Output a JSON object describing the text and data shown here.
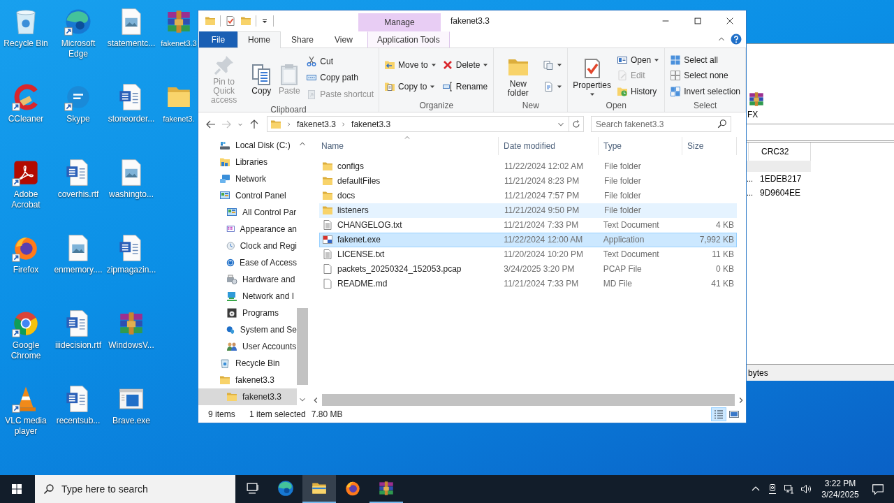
{
  "desktop_icons": [
    {
      "label": "Recycle Bin",
      "kind": "recycle-bin",
      "shortcut": false
    },
    {
      "label": "CCleaner",
      "kind": "ccleaner",
      "shortcut": true
    },
    {
      "label": "Adobe Acrobat",
      "kind": "pdf",
      "shortcut": true
    },
    {
      "label": "Firefox",
      "kind": "firefox",
      "shortcut": true
    },
    {
      "label": "Google Chrome",
      "kind": "chrome",
      "shortcut": true
    },
    {
      "label": "VLC media player",
      "kind": "vlc",
      "shortcut": true
    },
    {
      "label": "Microsoft Edge",
      "kind": "edge",
      "shortcut": true
    },
    {
      "label": "Skype",
      "kind": "skype",
      "shortcut": true
    },
    {
      "label": "coverhis.rtf",
      "kind": "word",
      "shortcut": false
    },
    {
      "label": "enmemory....",
      "kind": "image",
      "shortcut": false
    },
    {
      "label": "iiidecision.rtf",
      "kind": "word",
      "shortcut": false
    },
    {
      "label": "recentsub...",
      "kind": "word",
      "shortcut": false
    },
    {
      "label": "statementc...",
      "kind": "image",
      "shortcut": false
    },
    {
      "label": "stoneorder...",
      "kind": "word",
      "shortcut": false
    },
    {
      "label": "washingto...",
      "kind": "image",
      "shortcut": false
    },
    {
      "label": "zipmagazin...",
      "kind": "word",
      "shortcut": false
    },
    {
      "label": "WindowsV...",
      "kind": "archive",
      "shortcut": false
    },
    {
      "label": "Brave.exe",
      "kind": "app",
      "shortcut": false
    },
    {
      "label": "fakenet3.3",
      "kind": "archive",
      "shortcut": false
    },
    {
      "label": "fakenet3.",
      "kind": "folder",
      "shortcut": false
    }
  ],
  "background_window": {
    "toolbar_label": "FX",
    "crc_header": "CRC32",
    "rows": [
      {
        "column_1": "...",
        "crc32": "1EDEB217"
      },
      {
        "column_1": "...",
        "crc32": "9D9604EE"
      }
    ],
    "status": "bytes"
  },
  "explorer": {
    "quick_access": [
      {
        "kind": "folder"
      },
      {
        "kind": "properties"
      },
      {
        "kind": "folder"
      },
      {
        "kind": "customize"
      }
    ],
    "context_group": "Manage",
    "title": "fakenet3.3",
    "tabs": [
      {
        "label": "File",
        "kind": "file",
        "selected": false
      },
      {
        "label": "Home",
        "kind": "tab",
        "selected": true
      },
      {
        "label": "Share",
        "kind": "tab",
        "selected": false
      },
      {
        "label": "View",
        "kind": "tab",
        "selected": false
      },
      {
        "label": "Application Tools",
        "kind": "context",
        "selected": false
      }
    ],
    "ribbon": [
      {
        "label": "Clipboard",
        "columns": [
          [
            {
              "label": "Pin to Quick access",
              "kind": "pin",
              "disabled": true,
              "dropdown": false
            }
          ],
          [
            {
              "label": "Copy",
              "kind": "copy",
              "disabled": false,
              "dropdown": false
            }
          ],
          [
            {
              "label": "Paste",
              "kind": "paste",
              "disabled": true,
              "dropdown": false
            }
          ],
          [
            {
              "label": "Cut",
              "kind": "cut",
              "disabled": false,
              "dropdown": false
            },
            {
              "label": "Copy path",
              "kind": "copy-path",
              "disabled": false,
              "dropdown": false
            },
            {
              "label": "Paste shortcut",
              "kind": "paste-shortcut",
              "disabled": true,
              "dropdown": false
            }
          ]
        ]
      },
      {
        "label": "Organize",
        "columns": [
          [
            {
              "label": "Move to",
              "kind": "move-to",
              "disabled": false,
              "dropdown": true
            },
            {
              "label": "Copy to",
              "kind": "copy-to",
              "disabled": false,
              "dropdown": true
            }
          ],
          [
            {
              "label": "Delete",
              "kind": "delete",
              "disabled": false,
              "dropdown": true
            },
            {
              "label": "Rename",
              "kind": "rename",
              "disabled": false,
              "dropdown": false
            }
          ]
        ]
      },
      {
        "label": "New",
        "columns": [
          [
            {
              "label": "New folder",
              "kind": "folder",
              "disabled": false,
              "dropdown": false
            }
          ],
          [
            {
              "kind": "new-item",
              "disabled": false,
              "dropdown": true
            },
            {
              "kind": "easy-access",
              "disabled": false,
              "dropdown": true
            }
          ]
        ]
      },
      {
        "label": "Open",
        "columns": [
          [
            {
              "label": "Properties",
              "kind": "properties",
              "disabled": false,
              "dropdown": true
            }
          ],
          [
            {
              "label": "Open",
              "kind": "open",
              "disabled": false,
              "dropdown": true
            },
            {
              "label": "Edit",
              "kind": "edit",
              "disabled": true,
              "dropdown": false
            },
            {
              "label": "History",
              "kind": "history",
              "disabled": false,
              "dropdown": false
            }
          ]
        ]
      },
      {
        "label": "Select",
        "columns": [
          [
            {
              "label": "Select all",
              "kind": "select-all",
              "disabled": false,
              "dropdown": false
            },
            {
              "label": "Select none",
              "kind": "select-none",
              "disabled": false,
              "dropdown": false
            },
            {
              "label": "Invert selection",
              "kind": "invert",
              "disabled": false,
              "dropdown": false
            }
          ]
        ]
      }
    ],
    "nav_buttons": [
      {
        "kind": "back",
        "disabled": false
      },
      {
        "kind": "forward",
        "disabled": true
      },
      {
        "kind": "recent",
        "disabled": false
      },
      {
        "kind": "up",
        "disabled": false
      }
    ],
    "address": {
      "crumbs": [
        "fakenet3.3",
        "fakenet3.3"
      ]
    },
    "search": {
      "placeholder": "Search fakenet3.3"
    },
    "tree": [
      {
        "label": "Local Disk (C:)",
        "kind": "drive",
        "selected": false
      },
      {
        "label": "Libraries",
        "kind": "libraries",
        "selected": false
      },
      {
        "label": "Network",
        "kind": "network",
        "selected": false
      },
      {
        "label": "Control Panel",
        "kind": "control-panel",
        "selected": false,
        "children": [
          {
            "label": "All Control Par",
            "kind": "control-panel",
            "selected": false
          },
          {
            "label": "Appearance an",
            "kind": "appearance",
            "selected": false
          },
          {
            "label": "Clock and Regi",
            "kind": "clock",
            "selected": false
          },
          {
            "label": "Ease of Access",
            "kind": "access",
            "selected": false
          },
          {
            "label": "Hardware and",
            "kind": "hardware",
            "selected": false
          },
          {
            "label": "Network and I",
            "kind": "network-internet",
            "selected": false
          },
          {
            "label": "Programs",
            "kind": "programs",
            "selected": false
          },
          {
            "label": "System and Se",
            "kind": "security",
            "selected": false
          },
          {
            "label": "User Accounts",
            "kind": "users",
            "selected": false
          }
        ]
      },
      {
        "label": "Recycle Bin",
        "kind": "recycle-bin",
        "selected": false
      },
      {
        "label": "fakenet3.3",
        "kind": "folder",
        "selected": false,
        "children": [
          {
            "label": "fakenet3.3",
            "kind": "folder",
            "selected": true
          }
        ]
      }
    ],
    "columns": [
      {
        "label": "Name",
        "sorted": true
      },
      {
        "label": "Date modified",
        "sorted": false
      },
      {
        "label": "Type",
        "sorted": false
      },
      {
        "label": "Size",
        "sorted": false
      }
    ],
    "files": [
      {
        "name": "configs",
        "date": "11/22/2024 12:02 AM",
        "type": "File folder",
        "kind": "folder",
        "selected": false,
        "hovered": false
      },
      {
        "name": "defaultFiles",
        "date": "11/21/2024 8:23 PM",
        "type": "File folder",
        "kind": "folder",
        "selected": false,
        "hovered": false
      },
      {
        "name": "docs",
        "date": "11/21/2024 7:57 PM",
        "type": "File folder",
        "kind": "folder",
        "selected": false,
        "hovered": false
      },
      {
        "name": "listeners",
        "date": "11/21/2024 9:50 PM",
        "type": "File folder",
        "kind": "folder",
        "selected": false,
        "hovered": true
      },
      {
        "name": "CHANGELOG.txt",
        "date": "11/21/2024 7:33 PM",
        "type": "Text Document",
        "size": "4 KB",
        "kind": "text-file",
        "selected": false,
        "hovered": false
      },
      {
        "name": "fakenet.exe",
        "date": "11/22/2024 12:00 AM",
        "type": "Application",
        "size": "7,992 KB",
        "kind": "exe",
        "selected": true,
        "hovered": false
      },
      {
        "name": "LICENSE.txt",
        "date": "11/20/2024 10:20 PM",
        "type": "Text Document",
        "size": "11 KB",
        "kind": "text-file",
        "selected": false,
        "hovered": false
      },
      {
        "name": "packets_20250324_152053.pcap",
        "date": "3/24/2025 3:20 PM",
        "type": "PCAP File",
        "size": "0 KB",
        "kind": "blank-file",
        "selected": false,
        "hovered": false
      },
      {
        "name": "README.md",
        "date": "11/21/2024 7:33 PM",
        "type": "MD File",
        "size": "41 KB",
        "kind": "blank-file",
        "selected": false,
        "hovered": false
      }
    ],
    "status": {
      "count": "9 items",
      "selection": "1 item selected",
      "size": "7.80 MB"
    },
    "views": [
      {
        "kind": "details",
        "selected": true
      },
      {
        "kind": "large-icons",
        "selected": false
      }
    ]
  },
  "taskbar": {
    "search_placeholder": "Type here to search",
    "apps": [
      {
        "kind": "edge",
        "active": false,
        "running": false
      },
      {
        "kind": "explorer",
        "active": true,
        "running": true
      },
      {
        "kind": "firefox",
        "active": false,
        "running": false
      },
      {
        "kind": "archive",
        "active": false,
        "running": true
      }
    ],
    "time": "3:22 PM",
    "date": "3/24/2025"
  }
}
